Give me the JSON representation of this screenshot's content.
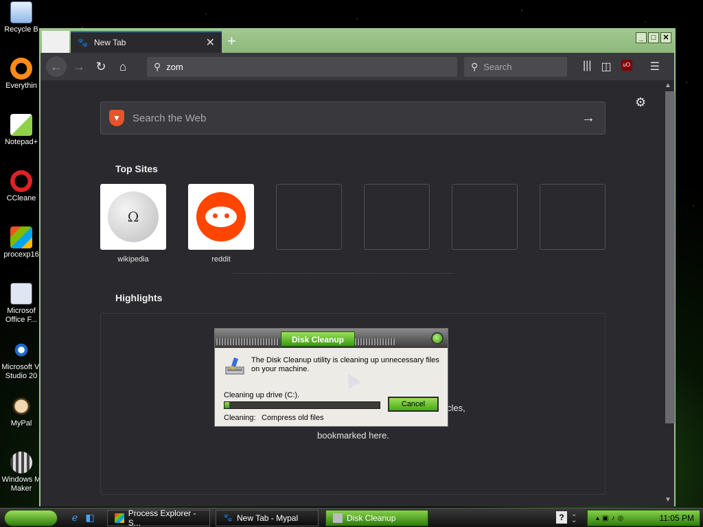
{
  "desktop": {
    "icons": [
      {
        "label": "Recycle B",
        "name": "recycle-bin-icon"
      },
      {
        "label": "Everythin",
        "name": "everything-icon"
      },
      {
        "label": "Notepad+",
        "name": "notepad-plus-icon"
      },
      {
        "label": "CCleane",
        "name": "ccleaner-icon"
      },
      {
        "label": "procexp16",
        "name": "process-explorer-icon"
      },
      {
        "label": "Microsof\nOffice F...",
        "name": "microsoft-office-icon"
      },
      {
        "label": "Microsoft Vi\nStudio 20",
        "name": "visual-studio-icon"
      },
      {
        "label": "MyPal",
        "name": "mypal-icon"
      },
      {
        "label": "Windows M\nMaker",
        "name": "movie-maker-icon"
      }
    ]
  },
  "browser": {
    "tab_title": "New Tab",
    "url_value": "zom",
    "search_placeholder": "Search",
    "content": {
      "web_search_placeholder": "Search the Web",
      "top_sites_title": "Top Sites",
      "top_sites": [
        {
          "label": "wikipedia"
        },
        {
          "label": "reddit"
        },
        {
          "label": ""
        },
        {
          "label": ""
        },
        {
          "label": ""
        },
        {
          "label": ""
        }
      ],
      "highlights_title": "Highlights",
      "highlights_fragment_1": "cles,",
      "highlights_fragment_2": "bookmarked here."
    }
  },
  "dialog": {
    "title": "Disk Cleanup",
    "message": "The Disk Cleanup utility is cleaning up unnecessary files on your machine.",
    "progress_label": "Cleaning up drive  (C:).",
    "progress_fraction": 0.03,
    "cancel_label": "Cancel",
    "status_label": "Cleaning:",
    "status_value": "Compress old files"
  },
  "taskbar": {
    "tasks": [
      {
        "label": "Process Explorer - S...",
        "active": false
      },
      {
        "label": "New Tab - Mypal",
        "active": false
      },
      {
        "label": "Disk Cleanup",
        "active": true
      }
    ],
    "help_label": "?",
    "clock": "11:05 PM"
  },
  "colors": {
    "accent_green": "#3c9a10",
    "browser_bg": "#2a2a2e",
    "tab_accent": "#0a84ff"
  }
}
